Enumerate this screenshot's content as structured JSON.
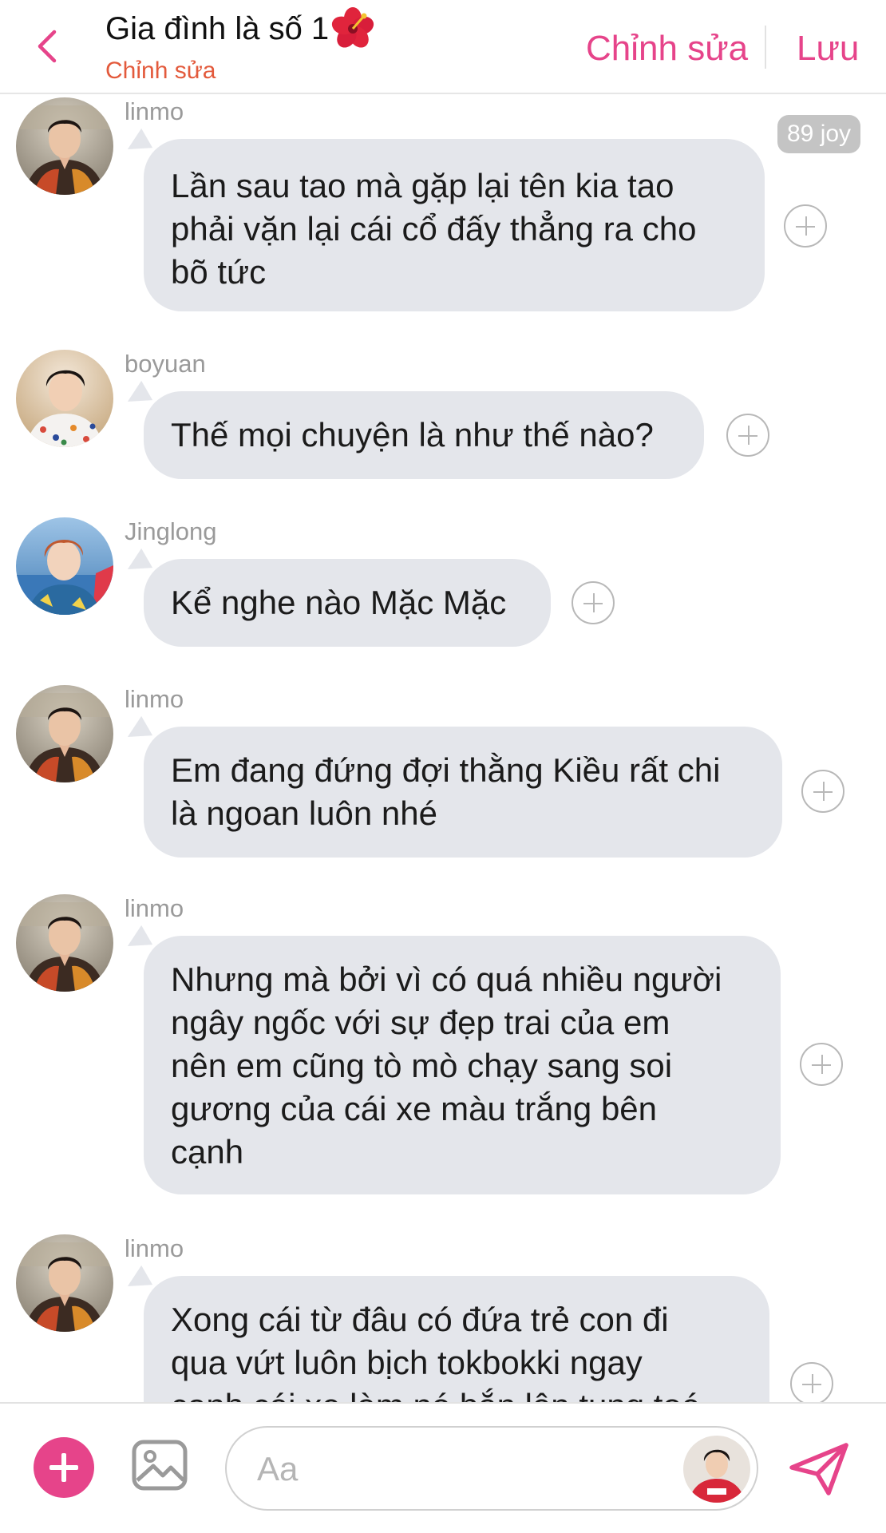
{
  "header": {
    "title": "Gia đình là số 1",
    "subtitle": "Chỉnh sửa",
    "edit_label": "Chỉnh sửa",
    "save_label": "Lưu"
  },
  "messages": [
    {
      "user": "linmo",
      "text_lines": [
        "Lần sau tao mà gặp lại tên kia tao",
        "phải vặn lại cái cổ đấy thẳng ra cho",
        "bõ tức"
      ],
      "badge": "89 joy"
    },
    {
      "user": "boyuan",
      "text_lines": [
        "Thế mọi chuyện là như thế nào?"
      ]
    },
    {
      "user": "Jinglong",
      "text_lines": [
        "Kể nghe nào Mặc Mặc"
      ]
    },
    {
      "user": "linmo",
      "text_lines": [
        "Em đang đứng đợi thằng Kiều rất chi",
        "là ngoan luôn nhé"
      ]
    },
    {
      "user": "linmo",
      "text_lines": [
        "Nhưng mà bởi vì có quá nhiều người",
        "ngây ngốc với sự đẹp trai của em",
        "nên em cũng tò mò chạy sang soi",
        "gương của cái xe màu trắng bên",
        "cạnh"
      ]
    },
    {
      "user": "linmo",
      "text_lines": [
        "Xong cái từ đâu có đứa trẻ con đi",
        "qua vứt luôn bịch tokbokki ngay",
        "cạnh cái xe làm nó bắn lên tung toé"
      ]
    }
  ],
  "composer": {
    "placeholder": "Aa"
  },
  "icons": {
    "back": "chevron-left-icon",
    "add": "plus-icon",
    "image": "image-icon",
    "send": "send-icon",
    "flower": "hibiscus-icon"
  },
  "colors": {
    "accent": "#e6448a",
    "subtitle": "#e35a3c",
    "bubble": "#e4e6eb",
    "badge": "#c4c4c4"
  }
}
